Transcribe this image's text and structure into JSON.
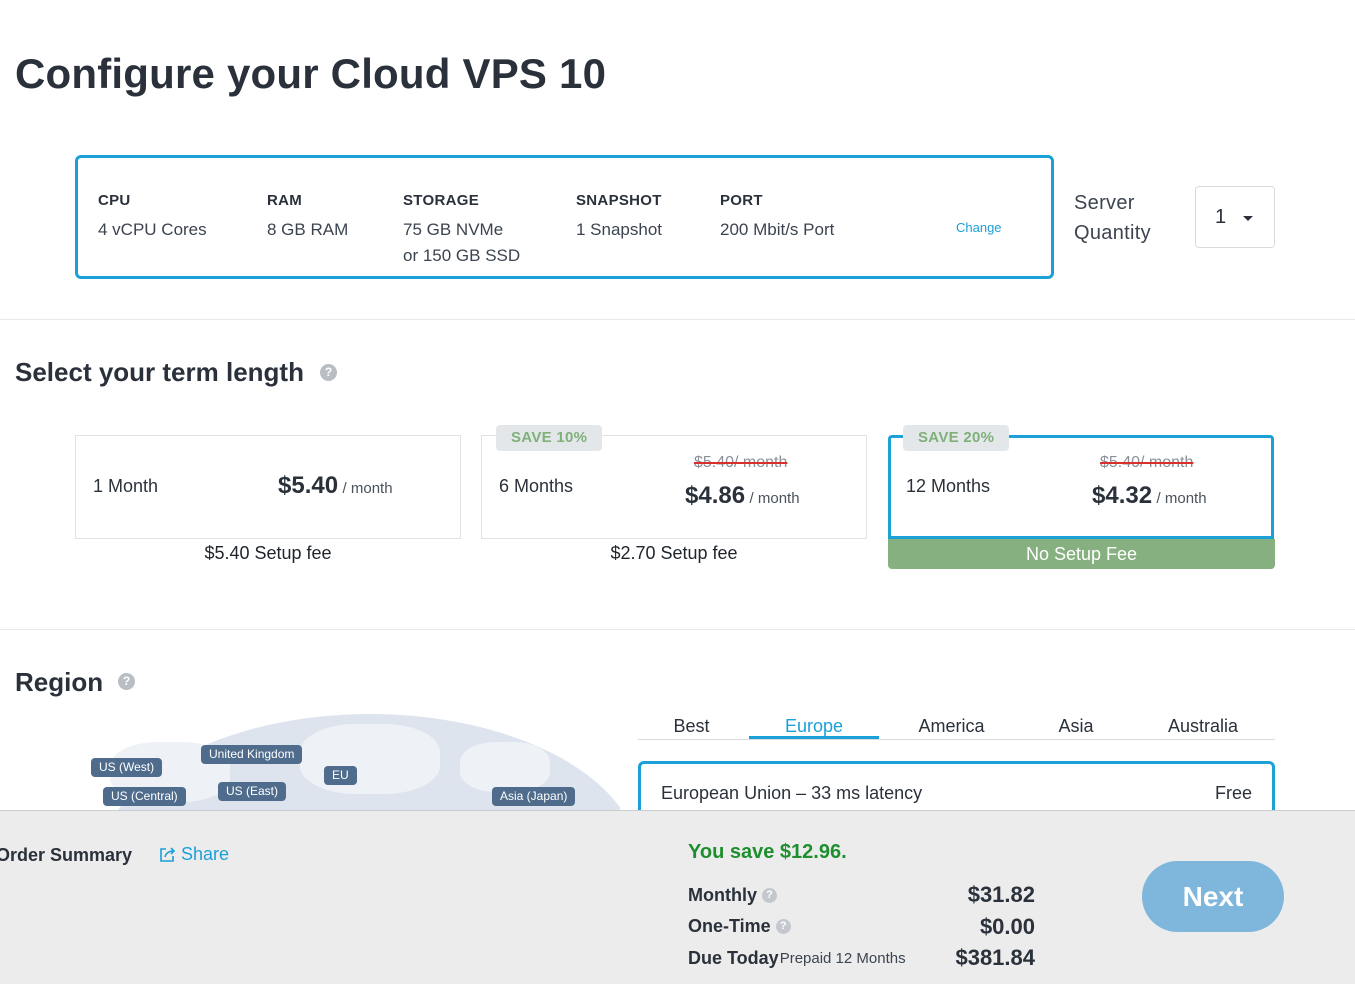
{
  "page": {
    "title": "Configure your Cloud VPS 10"
  },
  "specs": {
    "cpu": {
      "label": "CPU",
      "value": "4 vCPU Cores"
    },
    "ram": {
      "label": "RAM",
      "value": "8 GB RAM"
    },
    "storage": {
      "label": "STORAGE",
      "value_line1": "75 GB NVMe",
      "value_line2": "or 150 GB SSD"
    },
    "snapshot": {
      "label": "SNAPSHOT",
      "value": "1 Snapshot"
    },
    "port": {
      "label": "PORT",
      "value": "200 Mbit/s Port"
    },
    "change_label": "Change"
  },
  "quantity": {
    "label_line1": "Server",
    "label_line2": "Quantity",
    "selected": "1"
  },
  "term": {
    "title": "Select your term length",
    "help": "?",
    "options": [
      {
        "name": "1 Month",
        "price": "$5.40",
        "per": "/ month",
        "setup": "$5.40 Setup fee"
      },
      {
        "name": "6 Months",
        "badge": "SAVE 10%",
        "old_price": "$5.40/ month",
        "price": "$4.86",
        "per": "/ month",
        "setup": "$2.70 Setup fee"
      },
      {
        "name": "12 Months",
        "badge": "SAVE 20%",
        "old_price": "$5.40/ month",
        "price": "$4.32",
        "per": "/ month",
        "setup": "No Setup Fee",
        "selected": true
      }
    ]
  },
  "region": {
    "title": "Region",
    "help": "?",
    "map_tags": [
      "US (West)",
      "United Kingdom",
      "EU",
      "US (Central)",
      "US (East)",
      "Asia (Japan)"
    ],
    "tabs": [
      "Best",
      "Europe",
      "America",
      "Asia",
      "Australia"
    ],
    "active_tab": "Europe",
    "selected_region": {
      "name": "European Union – 33 ms latency",
      "price": "Free"
    }
  },
  "summary": {
    "title": "Order Summary",
    "share": "Share",
    "savings": "You save $12.96.",
    "monthly": {
      "label": "Monthly",
      "value": "$31.82"
    },
    "one_time": {
      "label": "One-Time",
      "value": "$0.00"
    },
    "due_today": {
      "label": "Due Today",
      "sub": "Prepaid 12 Months",
      "value": "$381.84"
    },
    "next": "Next"
  },
  "colors": {
    "accent": "#1ba0d8",
    "save_green": "#86b07f",
    "savings_text": "#1e8f2e",
    "next_button": "#7fb6dc"
  }
}
